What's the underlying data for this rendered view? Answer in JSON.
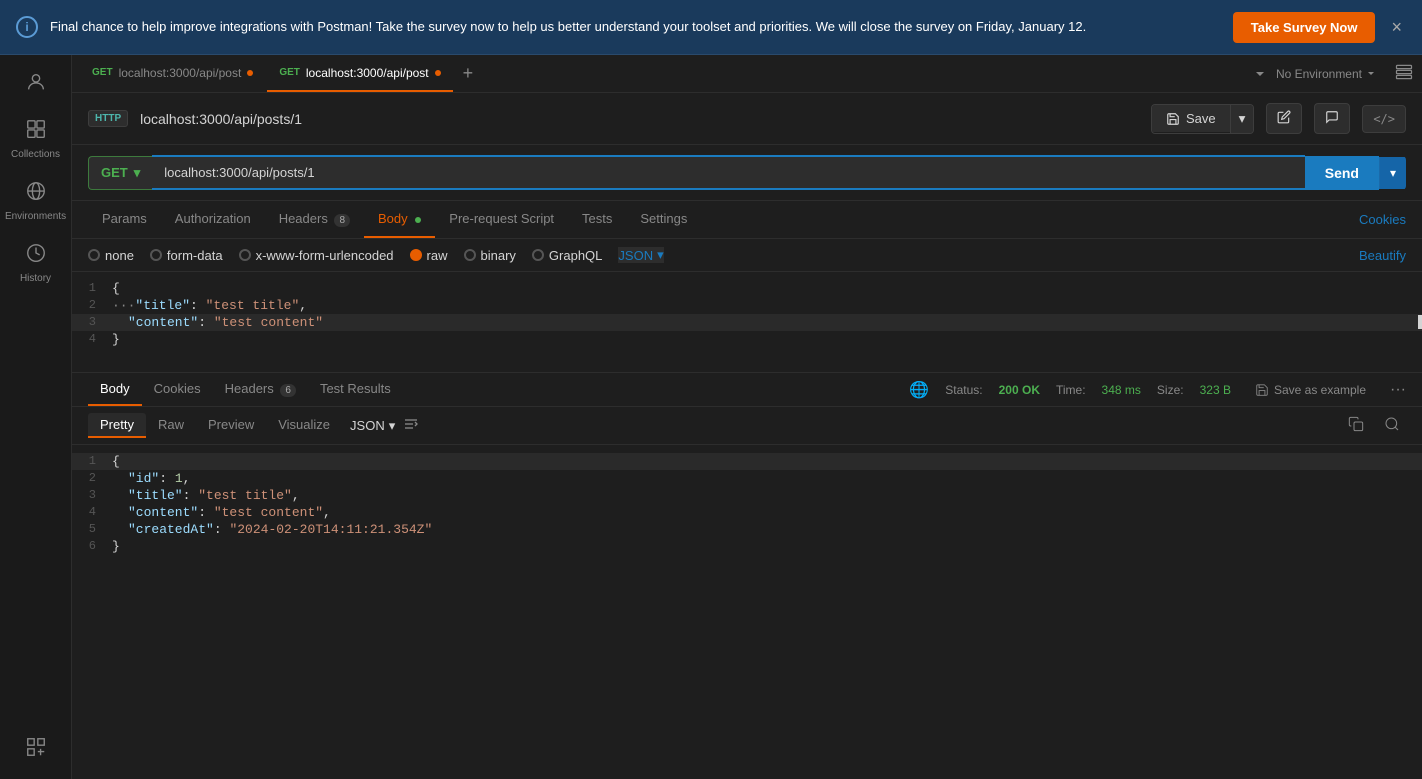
{
  "banner": {
    "text": "Final chance to help improve integrations with Postman! Take the survey now to help us better understand your toolset and priorities. We will close the survey on Friday, January 12.",
    "button_label": "Take Survey Now",
    "icon": "i"
  },
  "sidebar": {
    "items": [
      {
        "id": "profile",
        "label": "",
        "icon": "👤"
      },
      {
        "id": "collections",
        "label": "Collections",
        "icon": "📁"
      },
      {
        "id": "environments",
        "label": "Environments",
        "icon": "🌐"
      },
      {
        "id": "history",
        "label": "History",
        "icon": "🕐"
      },
      {
        "id": "components",
        "label": "",
        "icon": "⊞"
      }
    ]
  },
  "tabs": [
    {
      "id": "tab1",
      "method": "GET",
      "url": "localhost:3000/api/post",
      "active": false,
      "dirty": true
    },
    {
      "id": "tab2",
      "method": "GET",
      "url": "localhost:3000/api/post",
      "active": true,
      "dirty": true
    }
  ],
  "header": {
    "http_badge": "HTTP",
    "url_title": "localhost:3000/api/posts/1",
    "save_label": "Save",
    "no_env_label": "No Environment"
  },
  "request": {
    "method": "GET",
    "url": "localhost:3000/api/posts/1",
    "send_label": "Send"
  },
  "request_tabs": {
    "items": [
      {
        "id": "params",
        "label": "Params"
      },
      {
        "id": "auth",
        "label": "Authorization"
      },
      {
        "id": "headers",
        "label": "Headers",
        "badge": "8"
      },
      {
        "id": "body",
        "label": "Body",
        "active": true,
        "has_dot": true
      },
      {
        "id": "pre-request",
        "label": "Pre-request Script"
      },
      {
        "id": "tests",
        "label": "Tests"
      },
      {
        "id": "settings",
        "label": "Settings"
      }
    ],
    "cookies_label": "Cookies"
  },
  "body_options": [
    {
      "id": "none",
      "label": "none",
      "checked": false
    },
    {
      "id": "form-data",
      "label": "form-data",
      "checked": false
    },
    {
      "id": "urlencoded",
      "label": "x-www-form-urlencoded",
      "checked": false
    },
    {
      "id": "raw",
      "label": "raw",
      "checked": true
    },
    {
      "id": "binary",
      "label": "binary",
      "checked": false
    },
    {
      "id": "graphql",
      "label": "GraphQL",
      "checked": false
    }
  ],
  "json_label": "JSON",
  "beautify_label": "Beautify",
  "request_body": {
    "lines": [
      {
        "num": 1,
        "content": "{",
        "type": "brace"
      },
      {
        "num": 2,
        "content": "  \"title\": \"test title\",",
        "type": "kv"
      },
      {
        "num": 3,
        "content": "  \"content\": \"test content\"",
        "type": "kv",
        "highlighted": true
      },
      {
        "num": 4,
        "content": "}",
        "type": "brace"
      }
    ]
  },
  "response": {
    "tabs": [
      {
        "id": "body",
        "label": "Body",
        "active": true
      },
      {
        "id": "cookies",
        "label": "Cookies"
      },
      {
        "id": "headers",
        "label": "Headers",
        "badge": "6"
      },
      {
        "id": "test-results",
        "label": "Test Results"
      }
    ],
    "status_label": "Status:",
    "status_value": "200 OK",
    "time_label": "Time:",
    "time_value": "348 ms",
    "size_label": "Size:",
    "size_value": "323 B",
    "save_example_label": "Save as example",
    "body_tabs": [
      {
        "id": "pretty",
        "label": "Pretty",
        "active": true
      },
      {
        "id": "raw",
        "label": "Raw"
      },
      {
        "id": "preview",
        "label": "Preview"
      },
      {
        "id": "visualize",
        "label": "Visualize"
      }
    ],
    "json_format": "JSON",
    "lines": [
      {
        "num": 1,
        "content": "{"
      },
      {
        "num": 2,
        "content": "  \"id\": 1,",
        "id_key": true
      },
      {
        "num": 3,
        "content": "  \"title\": \"test title\","
      },
      {
        "num": 4,
        "content": "  \"content\": \"test content\","
      },
      {
        "num": 5,
        "content": "  \"createdAt\": \"2024-02-20T14:11:21.354Z\""
      },
      {
        "num": 6,
        "content": "}"
      }
    ]
  }
}
